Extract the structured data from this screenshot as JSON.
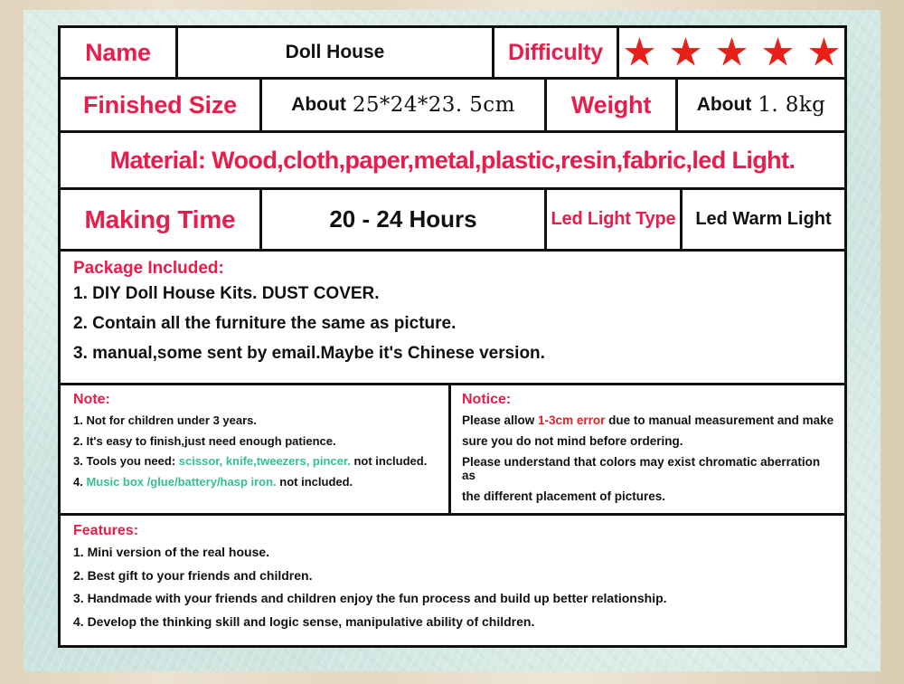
{
  "theme": {
    "label_red": "#e71d4c",
    "star_red": "#e8201a",
    "highlight_green": "#35c08d",
    "error_red": "#e8202a",
    "mat_mint": "#cfe6e1",
    "frame_tan": "#e7dcc6",
    "rule_black": "#101010"
  },
  "spec": {
    "name_label": "Name",
    "name_value": "Doll House",
    "difficulty_label": "Difficulty",
    "difficulty_rating": 5,
    "difficulty_star_glyph": "star-icon",
    "size_label": "Finished Size",
    "size_about": "About",
    "size_value": "25*24*23. 5cm",
    "weight_label": "Weight",
    "weight_about": "About",
    "weight_value": "1. 8kg",
    "material": "Material: Wood,cloth,paper,metal,plastic,resin,fabric,led Light.",
    "making_time_label": "Making Time",
    "making_time_value": "20 - 24 Hours",
    "led_light_type_label": "Led Light Type",
    "led_light_type_value": "Led Warm Light"
  },
  "package": {
    "title": "Package Included:",
    "items": [
      "1. DIY Doll House Kits. DUST COVER.",
      "2. Contain all the furniture the same as picture.",
      "3. manual,some sent by email.Maybe it's Chinese version."
    ]
  },
  "note": {
    "title": "Note:",
    "item1": "1. Not for children under 3 years.",
    "item2": "2. It's easy to finish,just need enough patience.",
    "item3_prefix": "3. Tools you need: ",
    "item3_highlight": "scissor, knife,tweezers, pincer.",
    "item3_suffix": " not included.",
    "item4_prefix": "4. ",
    "item4_highlight": "Music box /glue/battery/hasp iron.",
    "item4_suffix": " not included."
  },
  "notice": {
    "title": "Notice:",
    "line1_prefix": "Please allow ",
    "line1_highlight": "1-3cm error",
    "line1_suffix": " due to manual measurement and make",
    "line2": "sure you do not mind before ordering.",
    "line3": "Please understand that colors may exist chromatic aberration as",
    "line4": "the different placement of pictures."
  },
  "features": {
    "title": "Features:",
    "items": [
      "1. Mini version of the real house.",
      "2. Best gift to your friends and children.",
      "3. Handmade with your friends and children enjoy the fun process and build up better relationship.",
      "4. Develop the thinking skill and logic sense, manipulative ability of children."
    ]
  }
}
